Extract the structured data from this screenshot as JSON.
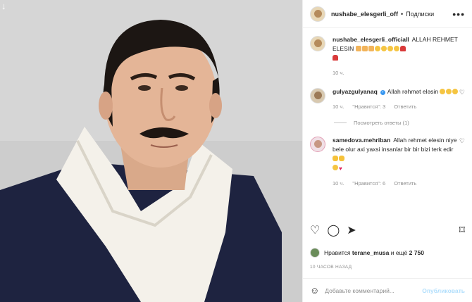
{
  "header": {
    "username": "nushabe_elesgerli_off",
    "separator": "•",
    "follow_label": "Подписки",
    "more": "•••"
  },
  "caption": {
    "username": "nushabe_elesgerli_officiall",
    "text": "ALLAH REHMET ELESIN",
    "time": "10 ч."
  },
  "comments": [
    {
      "username": "gulyazgulyanaq",
      "text": "Allah rəhmət eləsin",
      "time": "10 ч.",
      "likes": "\"Нравится\": 3",
      "reply": "Ответить",
      "view_replies": "Посмотреть ответы (1)"
    },
    {
      "username": "samedova.mehriban",
      "text": "Allah rehmet elesin niye bele olur axi yaxsi insanlar bir bir bizi terk edir",
      "time": "10 ч.",
      "likes": "\"Нравится\": 6",
      "reply": "Ответить"
    }
  ],
  "likes": {
    "prefix": "Нравится",
    "user": "terane_musa",
    "suffix": "и ещё",
    "count": "2 750"
  },
  "post_time": "10 ЧАСОВ НАЗАД",
  "add_comment": {
    "placeholder": "Добавьте комментарий...",
    "post_label": "Опубликовать"
  },
  "icons": {
    "like": "heart-outline-icon",
    "comment": "speech-bubble-icon",
    "share": "paper-plane-icon",
    "save": "bookmark-icon",
    "emoji": "smiley-icon",
    "download": "download-arrow-icon"
  },
  "colors": {
    "verified": "#3897f0",
    "post_button": "#b2dffc",
    "muted": "#8e8e8e"
  }
}
